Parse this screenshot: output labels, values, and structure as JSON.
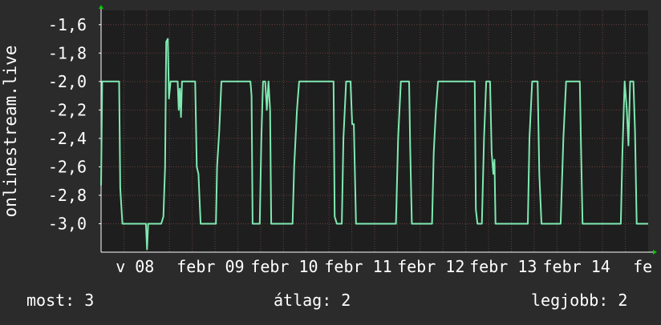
{
  "chart_data": {
    "type": "line",
    "ylabel": "onlinestream.live",
    "ylim": [
      -3.2,
      -1.5
    ],
    "yticks": [
      -1.6,
      -1.8,
      -2.0,
      -2.2,
      -2.4,
      -2.6,
      -2.8,
      -3.0
    ],
    "ytick_labels": [
      "-1,6",
      "-1,8",
      "-2,0",
      "-2,2",
      "-2,4",
      "-2,6",
      "-2,8",
      "-3,0"
    ],
    "xlim": [
      0,
      100
    ],
    "xtick_labels": [
      {
        "text": "v 08",
        "x": 6.2
      },
      {
        "text": "febr 09",
        "x": 20.0
      },
      {
        "text": "febr 10",
        "x": 33.5
      },
      {
        "text": "febr 11",
        "x": 47.0
      },
      {
        "text": "febr 12",
        "x": 60.3
      },
      {
        "text": "febr 13",
        "x": 73.5
      },
      {
        "text": "febr 14",
        "x": 86.9
      },
      {
        "text": "fe",
        "x": 99.0
      }
    ],
    "grid": true,
    "colors": {
      "background": "#2b2b2b",
      "plot_bg": "#1e1e1e",
      "grid": "#6b3f3f",
      "line": "#7fe9b1",
      "axis_arrow": "#00cc00",
      "text": "#ffffff"
    },
    "series": [
      {
        "points": [
          [
            0.0,
            -2.73
          ],
          [
            0.2,
            -2.0
          ],
          [
            3.3,
            -2.0
          ],
          [
            3.5,
            -2.75
          ],
          [
            3.9,
            -3.0
          ],
          [
            8.2,
            -3.0
          ],
          [
            8.4,
            -3.18
          ],
          [
            8.6,
            -3.0
          ],
          [
            11.0,
            -3.0
          ],
          [
            11.4,
            -2.95
          ],
          [
            11.7,
            -2.6
          ],
          [
            11.9,
            -1.72
          ],
          [
            12.2,
            -1.7
          ],
          [
            12.4,
            -2.12
          ],
          [
            12.7,
            -2.0
          ],
          [
            14.0,
            -2.0
          ],
          [
            14.2,
            -2.2
          ],
          [
            14.4,
            -2.05
          ],
          [
            14.6,
            -2.25
          ],
          [
            14.8,
            -2.0
          ],
          [
            17.2,
            -2.0
          ],
          [
            17.5,
            -2.6
          ],
          [
            17.8,
            -2.65
          ],
          [
            18.2,
            -3.0
          ],
          [
            21.0,
            -3.0
          ],
          [
            21.2,
            -2.6
          ],
          [
            21.6,
            -2.35
          ],
          [
            22.0,
            -2.0
          ],
          [
            27.3,
            -2.0
          ],
          [
            27.5,
            -2.1
          ],
          [
            27.7,
            -3.0
          ],
          [
            29.0,
            -3.0
          ],
          [
            29.3,
            -2.4
          ],
          [
            29.6,
            -2.0
          ],
          [
            30.0,
            -2.0
          ],
          [
            30.3,
            -2.2
          ],
          [
            30.6,
            -2.0
          ],
          [
            30.9,
            -2.2
          ],
          [
            31.1,
            -3.0
          ],
          [
            35.0,
            -3.0
          ],
          [
            35.3,
            -2.6
          ],
          [
            35.8,
            -2.2
          ],
          [
            36.2,
            -2.0
          ],
          [
            42.5,
            -2.0
          ],
          [
            42.7,
            -2.95
          ],
          [
            43.1,
            -3.0
          ],
          [
            44.0,
            -3.0
          ],
          [
            44.3,
            -2.4
          ],
          [
            44.8,
            -2.0
          ],
          [
            45.6,
            -2.0
          ],
          [
            45.9,
            -2.3
          ],
          [
            46.2,
            -2.3
          ],
          [
            46.6,
            -3.0
          ],
          [
            53.9,
            -3.0
          ],
          [
            54.3,
            -2.4
          ],
          [
            54.8,
            -2.0
          ],
          [
            56.3,
            -2.0
          ],
          [
            56.5,
            -2.45
          ],
          [
            56.8,
            -3.0
          ],
          [
            60.5,
            -3.0
          ],
          [
            60.8,
            -2.5
          ],
          [
            61.2,
            -2.2
          ],
          [
            61.6,
            -2.0
          ],
          [
            68.3,
            -2.0
          ],
          [
            68.5,
            -2.9
          ],
          [
            68.8,
            -3.0
          ],
          [
            69.6,
            -3.0
          ],
          [
            70.0,
            -2.4
          ],
          [
            70.4,
            -2.0
          ],
          [
            71.1,
            -2.0
          ],
          [
            71.4,
            -2.5
          ],
          [
            71.7,
            -2.65
          ],
          [
            71.9,
            -2.55
          ],
          [
            72.1,
            -3.0
          ],
          [
            78.0,
            -3.0
          ],
          [
            78.3,
            -2.4
          ],
          [
            78.8,
            -2.0
          ],
          [
            79.8,
            -2.0
          ],
          [
            80.1,
            -2.65
          ],
          [
            80.5,
            -3.0
          ],
          [
            84.0,
            -3.0
          ],
          [
            84.5,
            -2.4
          ],
          [
            85.0,
            -2.0
          ],
          [
            87.5,
            -2.0
          ],
          [
            87.7,
            -2.4
          ],
          [
            88.0,
            -3.0
          ],
          [
            95.0,
            -3.0
          ],
          [
            95.3,
            -2.5
          ],
          [
            95.7,
            -2.0
          ],
          [
            96.1,
            -2.2
          ],
          [
            96.4,
            -2.45
          ],
          [
            96.7,
            -2.0
          ],
          [
            97.3,
            -2.0
          ],
          [
            97.6,
            -2.35
          ],
          [
            97.9,
            -3.0
          ],
          [
            100.0,
            -3.0
          ]
        ]
      }
    ]
  },
  "footer": {
    "current": "most: 3",
    "average": "átlag: 2",
    "best": "legjobb: 2"
  }
}
